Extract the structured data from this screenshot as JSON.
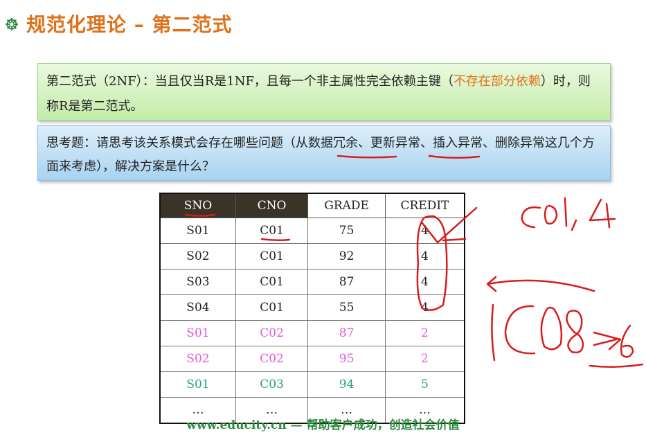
{
  "slide": {
    "title": "规范化理论 – 第二范式",
    "definition": {
      "text_before": "第二范式（2NF）：当且仅当R是1NF，且每一个非主属性完全依赖主键（",
      "highlight": "不存在部分依赖",
      "text_after": "）时，则称R是第二范式。"
    },
    "question": "思考题：请思考该关系模式会存在哪些问题（从数据冗余、更新异常、插入异常、删除异常这几个方面来考虑），解决方案是什么？",
    "table": {
      "headers": [
        "SNO",
        "CNO",
        "GRADE",
        "CREDIT"
      ],
      "rows": [
        {
          "style": "black",
          "cells": [
            "S01",
            "C01",
            "75",
            "4"
          ]
        },
        {
          "style": "black",
          "cells": [
            "S02",
            "C01",
            "92",
            "4"
          ]
        },
        {
          "style": "black",
          "cells": [
            "S03",
            "C01",
            "87",
            "4"
          ]
        },
        {
          "style": "black",
          "cells": [
            "S04",
            "C01",
            "55",
            "4"
          ]
        },
        {
          "style": "magenta",
          "cells": [
            "S01",
            "C02",
            "87",
            "2"
          ]
        },
        {
          "style": "magenta",
          "cells": [
            "S02",
            "C02",
            "95",
            "2"
          ]
        },
        {
          "style": "green",
          "cells": [
            "S01",
            "C03",
            "94",
            "5"
          ]
        },
        {
          "style": "black",
          "cells": [
            "…",
            "…",
            "…",
            "…"
          ]
        }
      ]
    },
    "footer": "www.educity.cn — 帮助客户成功，创造社会价值",
    "colors": {
      "title": "#e0701a",
      "highlight": "#e0701a",
      "magenta_row": "#e35ad6",
      "green_row": "#23a37a",
      "footer": "#2f8a3e",
      "ink": "#d81c1c"
    },
    "icons": [
      "flower-bullet-icon"
    ]
  }
}
